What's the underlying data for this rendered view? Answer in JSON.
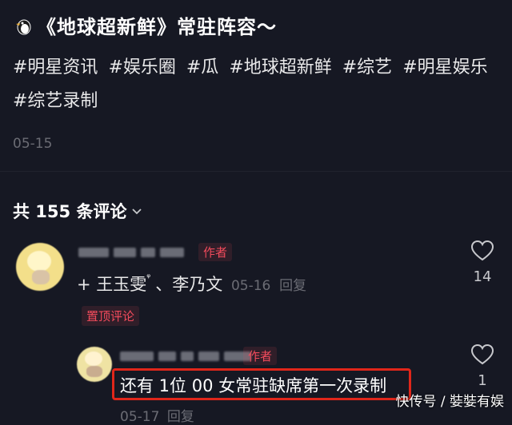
{
  "post": {
    "title": "《地球超新鲜》常驻阵容～",
    "title_icon": "penguin-icon",
    "tags": [
      "#明星资讯",
      "#娱乐圈",
      "#瓜",
      "#地球超新鲜",
      "#综艺",
      "#明星娱乐",
      "#综艺录制"
    ],
    "date": "05-15"
  },
  "comments_header": {
    "label": "共 155 条评论",
    "chevron": "chevron-down-icon"
  },
  "comment": {
    "author_badge": "作者",
    "mention": "+ 王玉雯",
    "separator": "、李乃文",
    "date": "05-16",
    "reply": "回复",
    "pinned_badge": "置顶评论",
    "likes": "14"
  },
  "reply": {
    "author_badge": "作者",
    "text": "还有 1位 00 女常驻缺席第一次录制",
    "date": "05-17",
    "reply": "回复",
    "likes": "1"
  },
  "watermark": "快传号 / 娤娤有娱",
  "colors": {
    "background": "#161823",
    "accent_red": "#f24b5c",
    "highlight_border": "#e0261a",
    "muted_text": "#6b6c74"
  }
}
